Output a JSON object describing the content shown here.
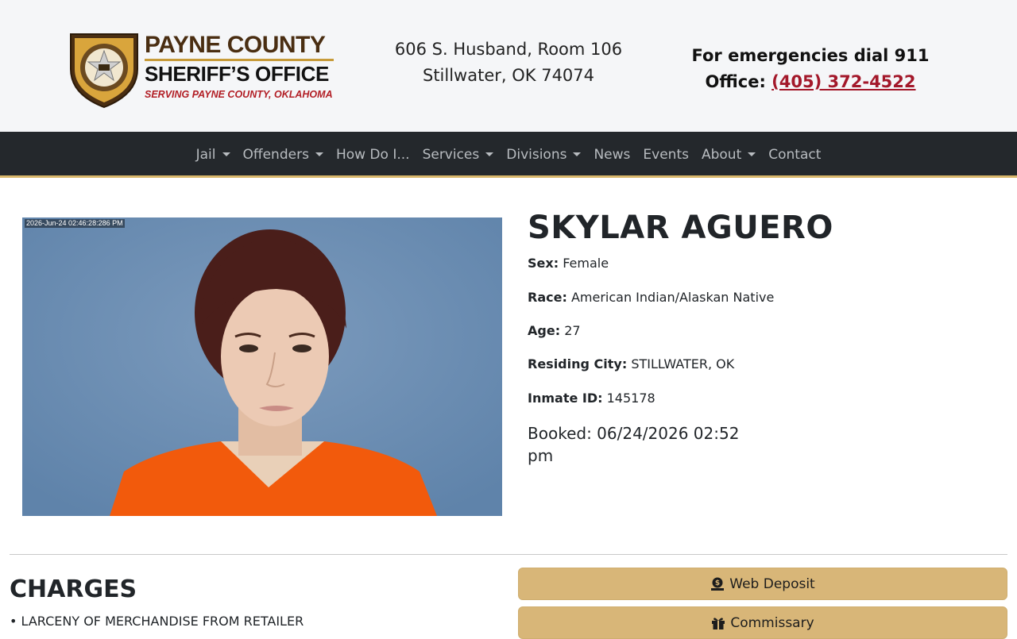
{
  "header": {
    "logo": {
      "line1": "PAYNE COUNTY",
      "line2": "SHERIFF’S OFFICE",
      "line3": "SERVING PAYNE COUNTY, OKLAHOMA",
      "badge_top_text": "PAYNE COUNTY",
      "badge_bottom_text": "SHERIFF'S OFFICE"
    },
    "address_line1": "606 S. Husband, Room 106",
    "address_line2": "Stillwater, OK 74074",
    "emergency_text": "For emergencies dial 911",
    "office_label": "Office:",
    "office_phone": "(405) 372-4522"
  },
  "nav": {
    "items": [
      {
        "label": "Jail",
        "dropdown": true
      },
      {
        "label": "Offenders",
        "dropdown": true
      },
      {
        "label": "How Do I...",
        "dropdown": false
      },
      {
        "label": "Services",
        "dropdown": true
      },
      {
        "label": "Divisions",
        "dropdown": true
      },
      {
        "label": "News",
        "dropdown": false
      },
      {
        "label": "Events",
        "dropdown": false
      },
      {
        "label": "About",
        "dropdown": true
      },
      {
        "label": "Contact",
        "dropdown": false
      }
    ]
  },
  "inmate": {
    "photo_timestamp": "2026-Jun-24 02:46:28:286 PM",
    "name": "SKYLAR AGUERO",
    "sex_label": "Sex:",
    "sex": "Female",
    "race_label": "Race:",
    "race": "American Indian/Alaskan Native",
    "age_label": "Age:",
    "age": "27",
    "city_label": "Residing City:",
    "city": "STILLWATER, OK",
    "id_label": "Inmate ID:",
    "id": "145178",
    "booked_label": "Booked:",
    "booked": "06/24/2026 02:52 pm"
  },
  "charges": {
    "heading": "CHARGES",
    "items": [
      "LARCENY OF MERCHANDISE FROM RETAILER"
    ]
  },
  "actions": {
    "web_deposit": "Web Deposit",
    "commissary": "Commissary"
  },
  "colors": {
    "nav_bg": "#24282c",
    "accent_gold": "#d8b678",
    "phone_red": "#a3182a",
    "logo_brown": "#4a2e12",
    "jumpsuit_orange": "#f25a0c"
  }
}
